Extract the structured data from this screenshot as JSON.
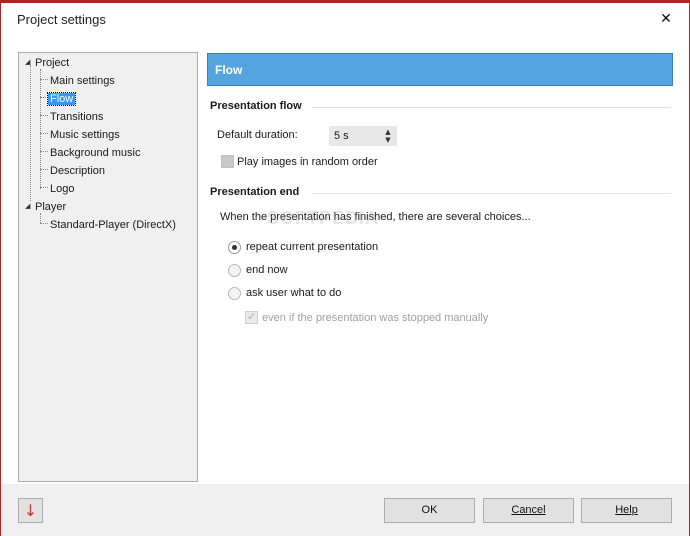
{
  "window": {
    "title": "Project settings",
    "close_glyph": "✕"
  },
  "tree": {
    "items": [
      {
        "label": "Project",
        "level": 0,
        "expanded": true
      },
      {
        "label": "Main settings",
        "level": 1
      },
      {
        "label": "Flow",
        "level": 1,
        "selected": true
      },
      {
        "label": "Transitions",
        "level": 1
      },
      {
        "label": "Music settings",
        "level": 1
      },
      {
        "label": "Background music",
        "level": 1
      },
      {
        "label": "Description",
        "level": 1
      },
      {
        "label": "Logo",
        "level": 1
      },
      {
        "label": "Player",
        "level": 0,
        "expanded": true
      },
      {
        "label": "Standard-Player (DirectX)",
        "level": 1
      }
    ],
    "expander_glyph": "◢"
  },
  "panel": {
    "header_title": "Flow",
    "header_color": "#54a4df",
    "presentation_flow": {
      "section_title": "Presentation flow",
      "duration_label": "Default duration:",
      "duration_value": "5 s",
      "random_order_label": "Play images in random order",
      "random_order_checked": false
    },
    "presentation_end": {
      "section_title": "Presentation end",
      "description": "When the presentation has finished, there are several choices...",
      "options": [
        {
          "label": "repeat current presentation",
          "checked": true
        },
        {
          "label": "end now",
          "checked": false
        },
        {
          "label": "ask user what to do",
          "checked": false
        }
      ],
      "sub_option_label": "even if the presentation was stopped manually",
      "sub_option_checked": true,
      "sub_option_enabled": false
    }
  },
  "footer": {
    "ok_label": "OK",
    "cancel_label": "Cancel",
    "help_label": "Help",
    "down_arrow_glyph": "↓"
  },
  "watermark_text": "SOFTPEDIA"
}
